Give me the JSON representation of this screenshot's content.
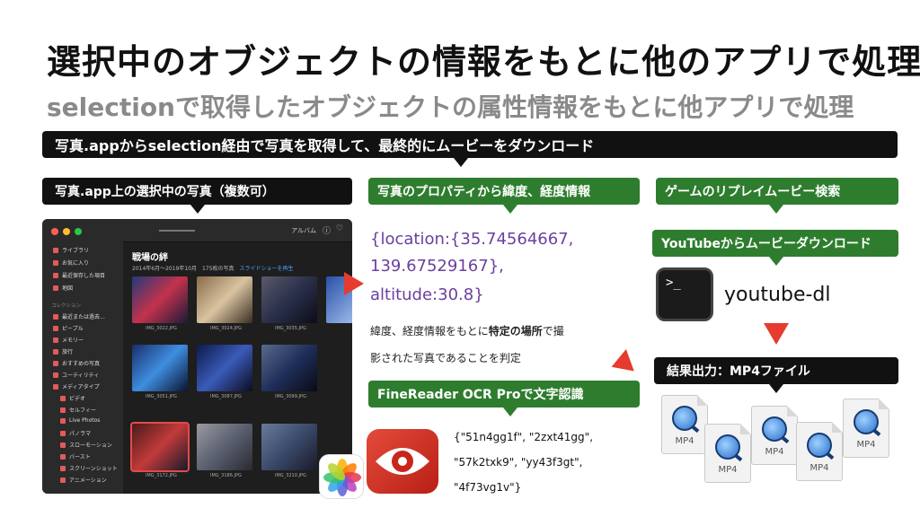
{
  "title": "選択中のオブジェクトの情報をもとに他のアプリで処理",
  "subtitle": "selectionで取得したオブジェクトの属性情報をもとに他アプリで処理",
  "top_banner": "写真.appからselection経由で写真を取得して、最終的にムービーをダウンロード",
  "left_banner": "写真.app上の選択中の写真（複数可）",
  "mid_banner": "写真のプロパティから緯度、経度情報",
  "right_banner": "ゲームのリプレイムービー検索",
  "yt_banner": "YouTubeからムービーダウンロード",
  "result_banner": "結果出力：MP4ファイル",
  "ocr_banner": "FineReader OCR Proで文字認識",
  "location": {
    "line1": "{location:{35.74564667,",
    "line2": "139.67529167},",
    "line3": "altitude:30.8}"
  },
  "desc": {
    "line1_pre": "緯度、経度情報をもとに",
    "line1_bold": "特定の場所",
    "line1_post": "で撮",
    "line2": "影された写真であることを判定"
  },
  "ocr_result": {
    "line1": "{\"51n4gg1f\", \"2zxt41gg\",",
    "line2": "\"57k2txk9\", \"yy43f3gt\",",
    "line3": "\"4f73vg1v\"}"
  },
  "terminal_prompt": ">_",
  "ytdl_label": "youtube-dl",
  "mp4_label": "MP4",
  "photos_window": {
    "toolbar_album": "アルバム",
    "album_title": "戦場の絆",
    "album_sub": "2014年6月〜2019年10月　175枚の写真",
    "slideshow": "スライドショーを再生",
    "sidebar": {
      "items": [
        "ライブラリ",
        "お気に入り",
        "最近保存した項目",
        "地図"
      ],
      "section": "コレクション",
      "collection_items": [
        "最近または過去…",
        "ピープル",
        "メモリー",
        "旅行",
        "おすすめの写真",
        "ユーティリティ",
        "メディアタイプ",
        "ビデオ",
        "セルフィー",
        "Live Photos",
        "パノラマ",
        "スローモーション",
        "バースト",
        "スクリーンショット",
        "アニメーション"
      ]
    },
    "thumbs": [
      "IMG_3022.JPG",
      "IMG_3024.JPG",
      "IMG_3035.JPG",
      "IMG_3051.JPG",
      "IMG_3087.JPG",
      "IMG_3099.JPG",
      "IMG_3172.JPG",
      "IMG_3186.JPG",
      "IMG_3210.JPG"
    ]
  },
  "colors": {
    "accent_green": "#2e7d2e",
    "arrow_red": "#e63b2e",
    "location_purple": "#6b3fa0"
  }
}
